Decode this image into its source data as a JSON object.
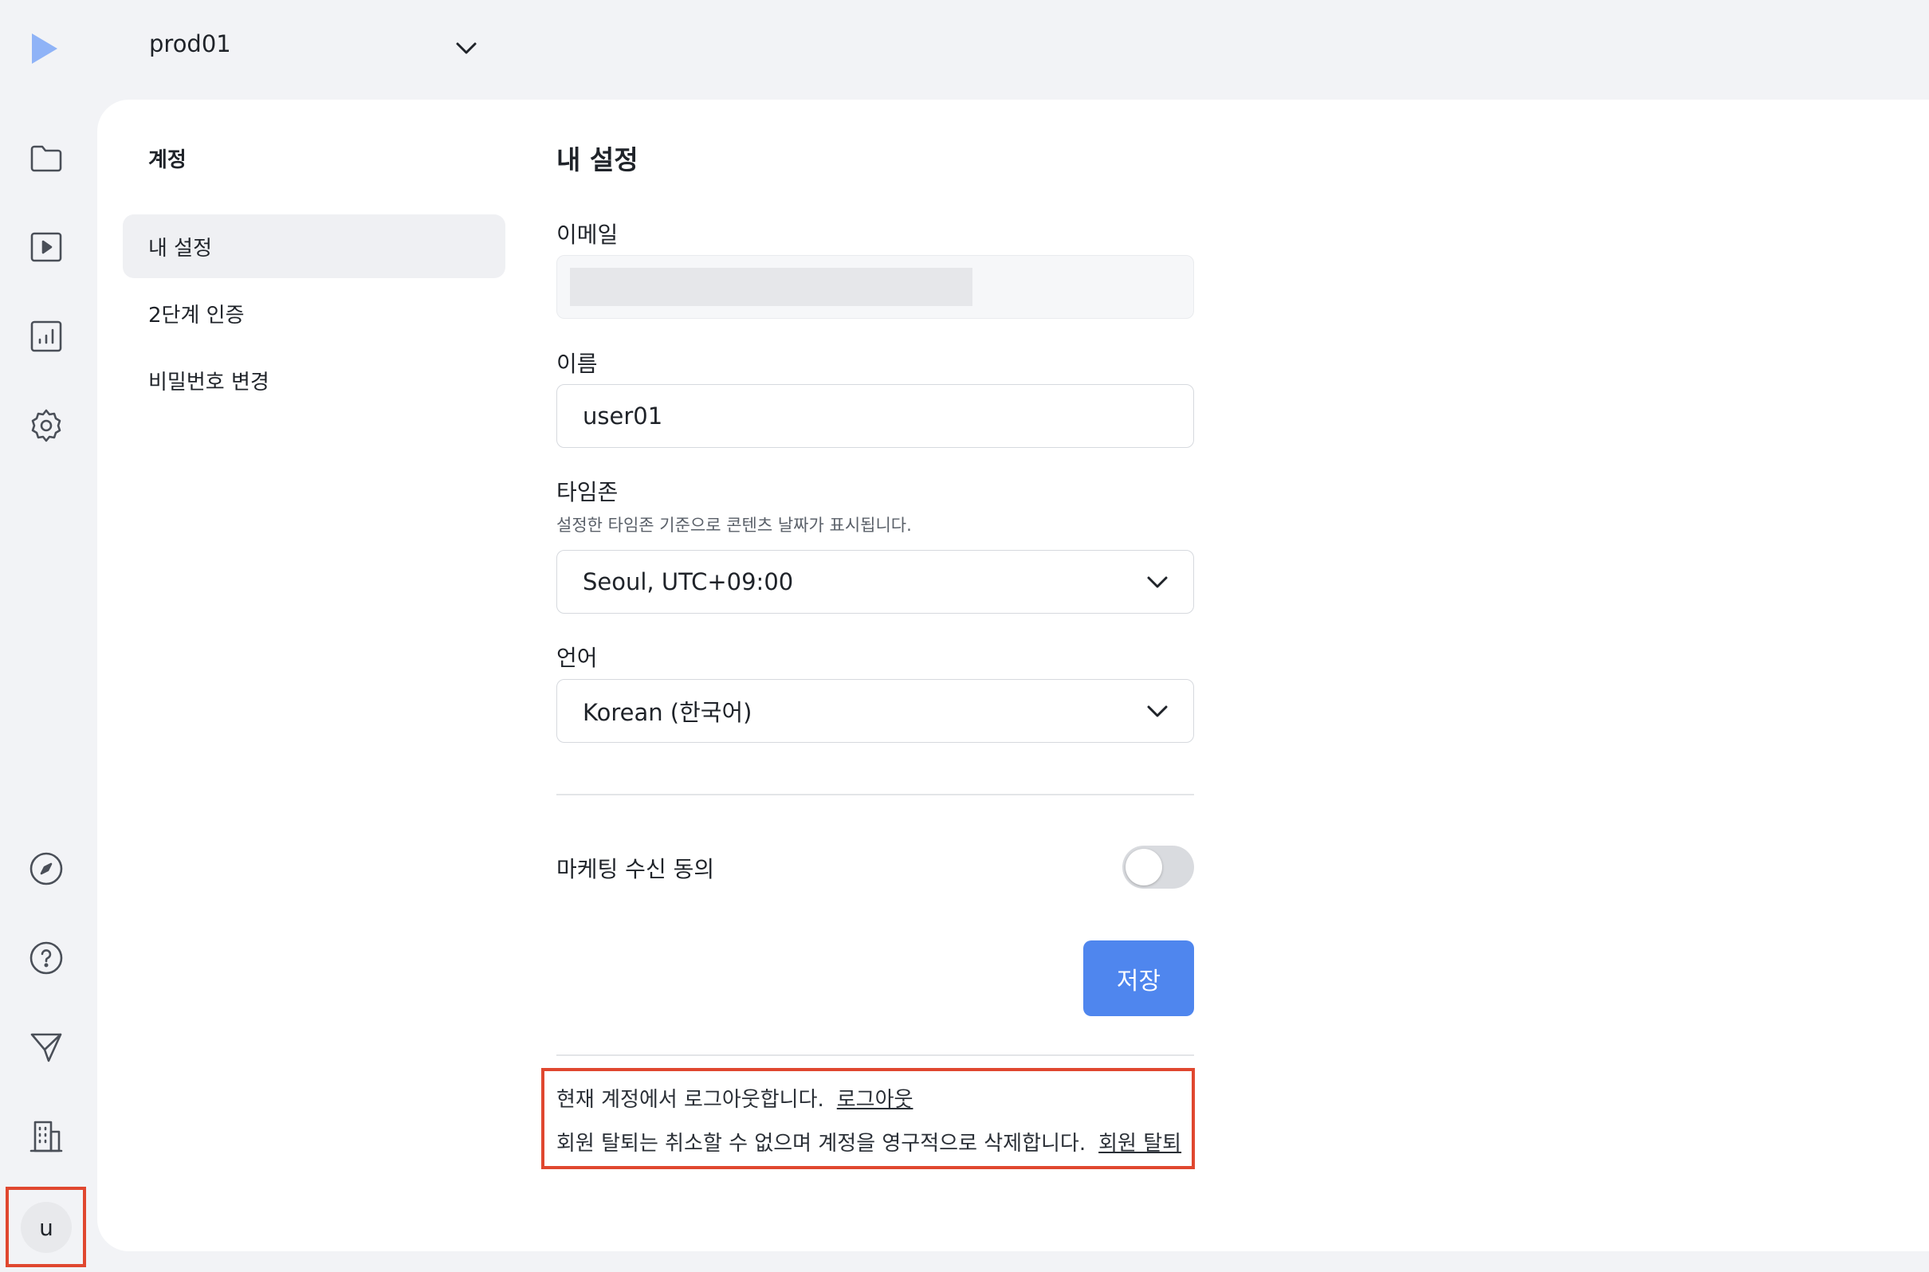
{
  "topbar": {
    "workspace": "prod01",
    "icons": {
      "logo": "play-logo-icon",
      "workspace_dropdown": "chevron-down-icon"
    }
  },
  "rail": {
    "top_icons": [
      "folder-icon",
      "play-square-icon",
      "chart-icon",
      "gear-icon"
    ],
    "bottom_icons": [
      "compass-icon",
      "help-circle-icon",
      "send-icon",
      "building-icon"
    ],
    "avatar": "u"
  },
  "subnav": {
    "title": "계정",
    "items": [
      {
        "label": "내 설정",
        "active": true
      },
      {
        "label": "2단계 인증",
        "active": false
      },
      {
        "label": "비밀번호 변경",
        "active": false
      }
    ]
  },
  "settings": {
    "title": "내 설정",
    "email": {
      "label": "이메일",
      "value": ""
    },
    "name": {
      "label": "이름",
      "value": "user01"
    },
    "timezone": {
      "label": "타임존",
      "help": "설정한 타임존 기준으로 콘텐츠 날짜가 표시됩니다.",
      "value": "Seoul, UTC+09:00"
    },
    "language": {
      "label": "언어",
      "value": "Korean (한국어)"
    },
    "marketing": {
      "label": "마케팅 수신 동의",
      "enabled": false
    },
    "save_label": "저장"
  },
  "account": {
    "logout_text": "현재 계정에서 로그아웃합니다.",
    "logout_link": "로그아웃",
    "withdraw_text": "회원 탈퇴는 취소할 수 없으며 계정을 영구적으로 삭제합니다.",
    "withdraw_link": "회원 탈퇴"
  },
  "colors": {
    "accent": "#4f86ee",
    "highlight": "#e0472f",
    "logo": "#8fb3f7"
  }
}
